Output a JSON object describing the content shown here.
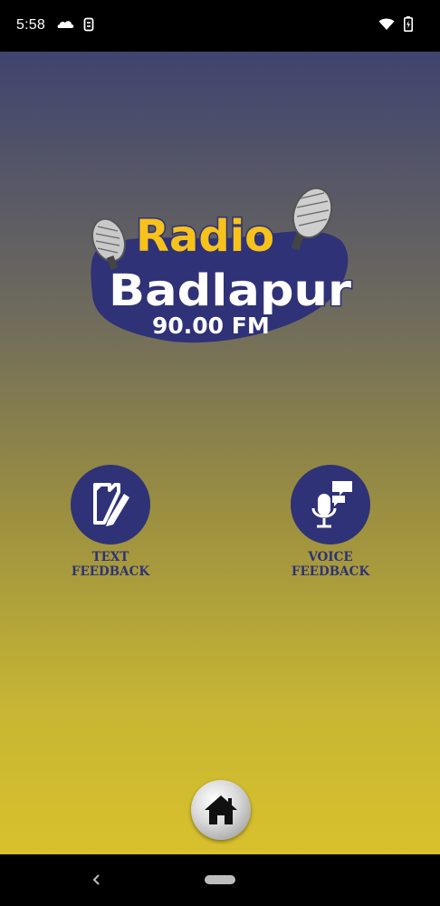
{
  "status_bar": {
    "time": "5:58",
    "left_icons": [
      "cloud-icon",
      "storage-icon"
    ],
    "right_icons": [
      "wifi-icon",
      "battery-icon"
    ]
  },
  "logo": {
    "line1": "Radio",
    "line2": "Badlapur",
    "line3": "90.00 FM"
  },
  "buttons": {
    "text_feedback": {
      "line1": "TEXT",
      "line2": "FEEDBACK",
      "icon": "document-edit-icon"
    },
    "voice_feedback": {
      "line1": "VOICE",
      "line2": "FEEDBACK",
      "icon": "microphone-chat-icon"
    },
    "home": {
      "icon": "home-icon"
    }
  },
  "colors": {
    "button_circle": "#2f3277",
    "logo_yellow": "#f7c21b",
    "gradient_top": "#3f4470",
    "gradient_bottom": "#d9c12c"
  }
}
